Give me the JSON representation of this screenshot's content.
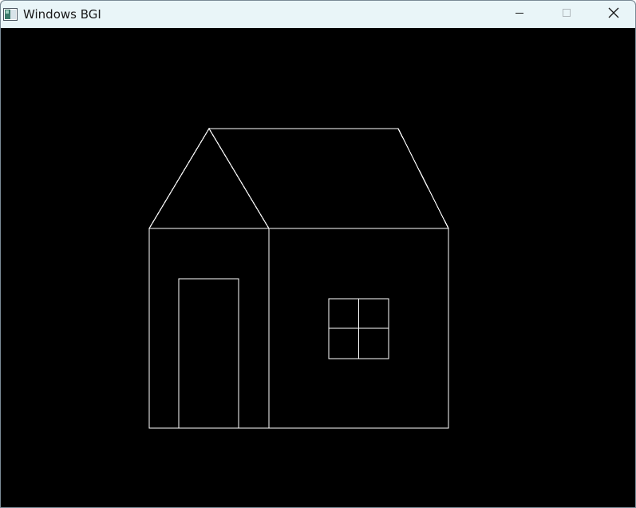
{
  "window": {
    "title": "Windows BGI",
    "icon": "bgi-app-icon",
    "canvas_background": "#000000",
    "stroke_color": "#ffffff",
    "titlebar_color": "#e9f5f8"
  },
  "controls": {
    "minimize_icon": "minimize-icon",
    "maximize_icon": "maximize-icon",
    "close_icon": "close-icon"
  },
  "drawing": {
    "subject": "house",
    "parts": [
      "gable-roof",
      "side-roof",
      "front-wall",
      "side-wall",
      "door",
      "window-pane-grid"
    ]
  }
}
